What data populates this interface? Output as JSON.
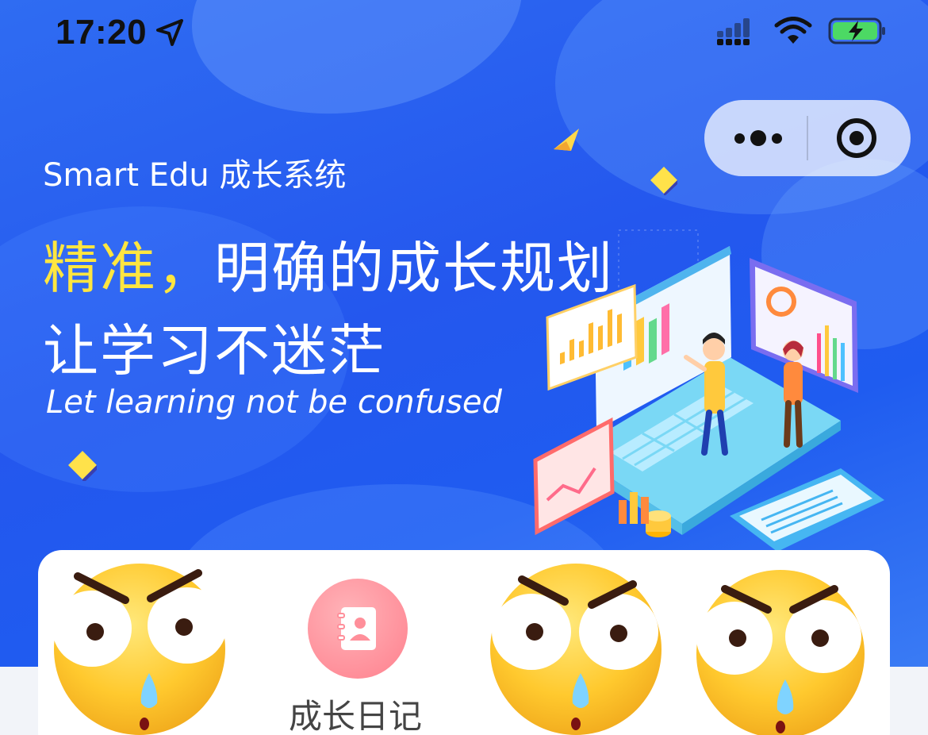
{
  "status_bar": {
    "time": "17:20",
    "icons": [
      "location-arrow-icon",
      "signal-icon",
      "wifi-icon",
      "battery-charging-icon"
    ]
  },
  "capsule": {
    "icons": [
      "more-dots-icon",
      "close-target-icon"
    ]
  },
  "banner": {
    "brand": "Smart Edu 成长系统",
    "headline_highlight": "精准，",
    "headline_rest": "明确的成长规划",
    "headline_line2": "让学习不迷茫",
    "tagline": "Let learning not be confused",
    "illustration": "analytics-laptop-illustration"
  },
  "menu": {
    "items": [
      {
        "label": "",
        "icon": "angry-emoji-sticker"
      },
      {
        "label": "成长日记",
        "icon": "diary-contact-book-icon"
      },
      {
        "label": "",
        "icon": "angry-emoji-sticker"
      },
      {
        "label": "",
        "icon": "angry-emoji-sticker"
      }
    ]
  },
  "colors": {
    "banner_blue": "#2457ee",
    "highlight_yellow": "#ffe640",
    "diary_icon_pink": "#ff8f9a",
    "page_bg": "#f2f4f9"
  }
}
